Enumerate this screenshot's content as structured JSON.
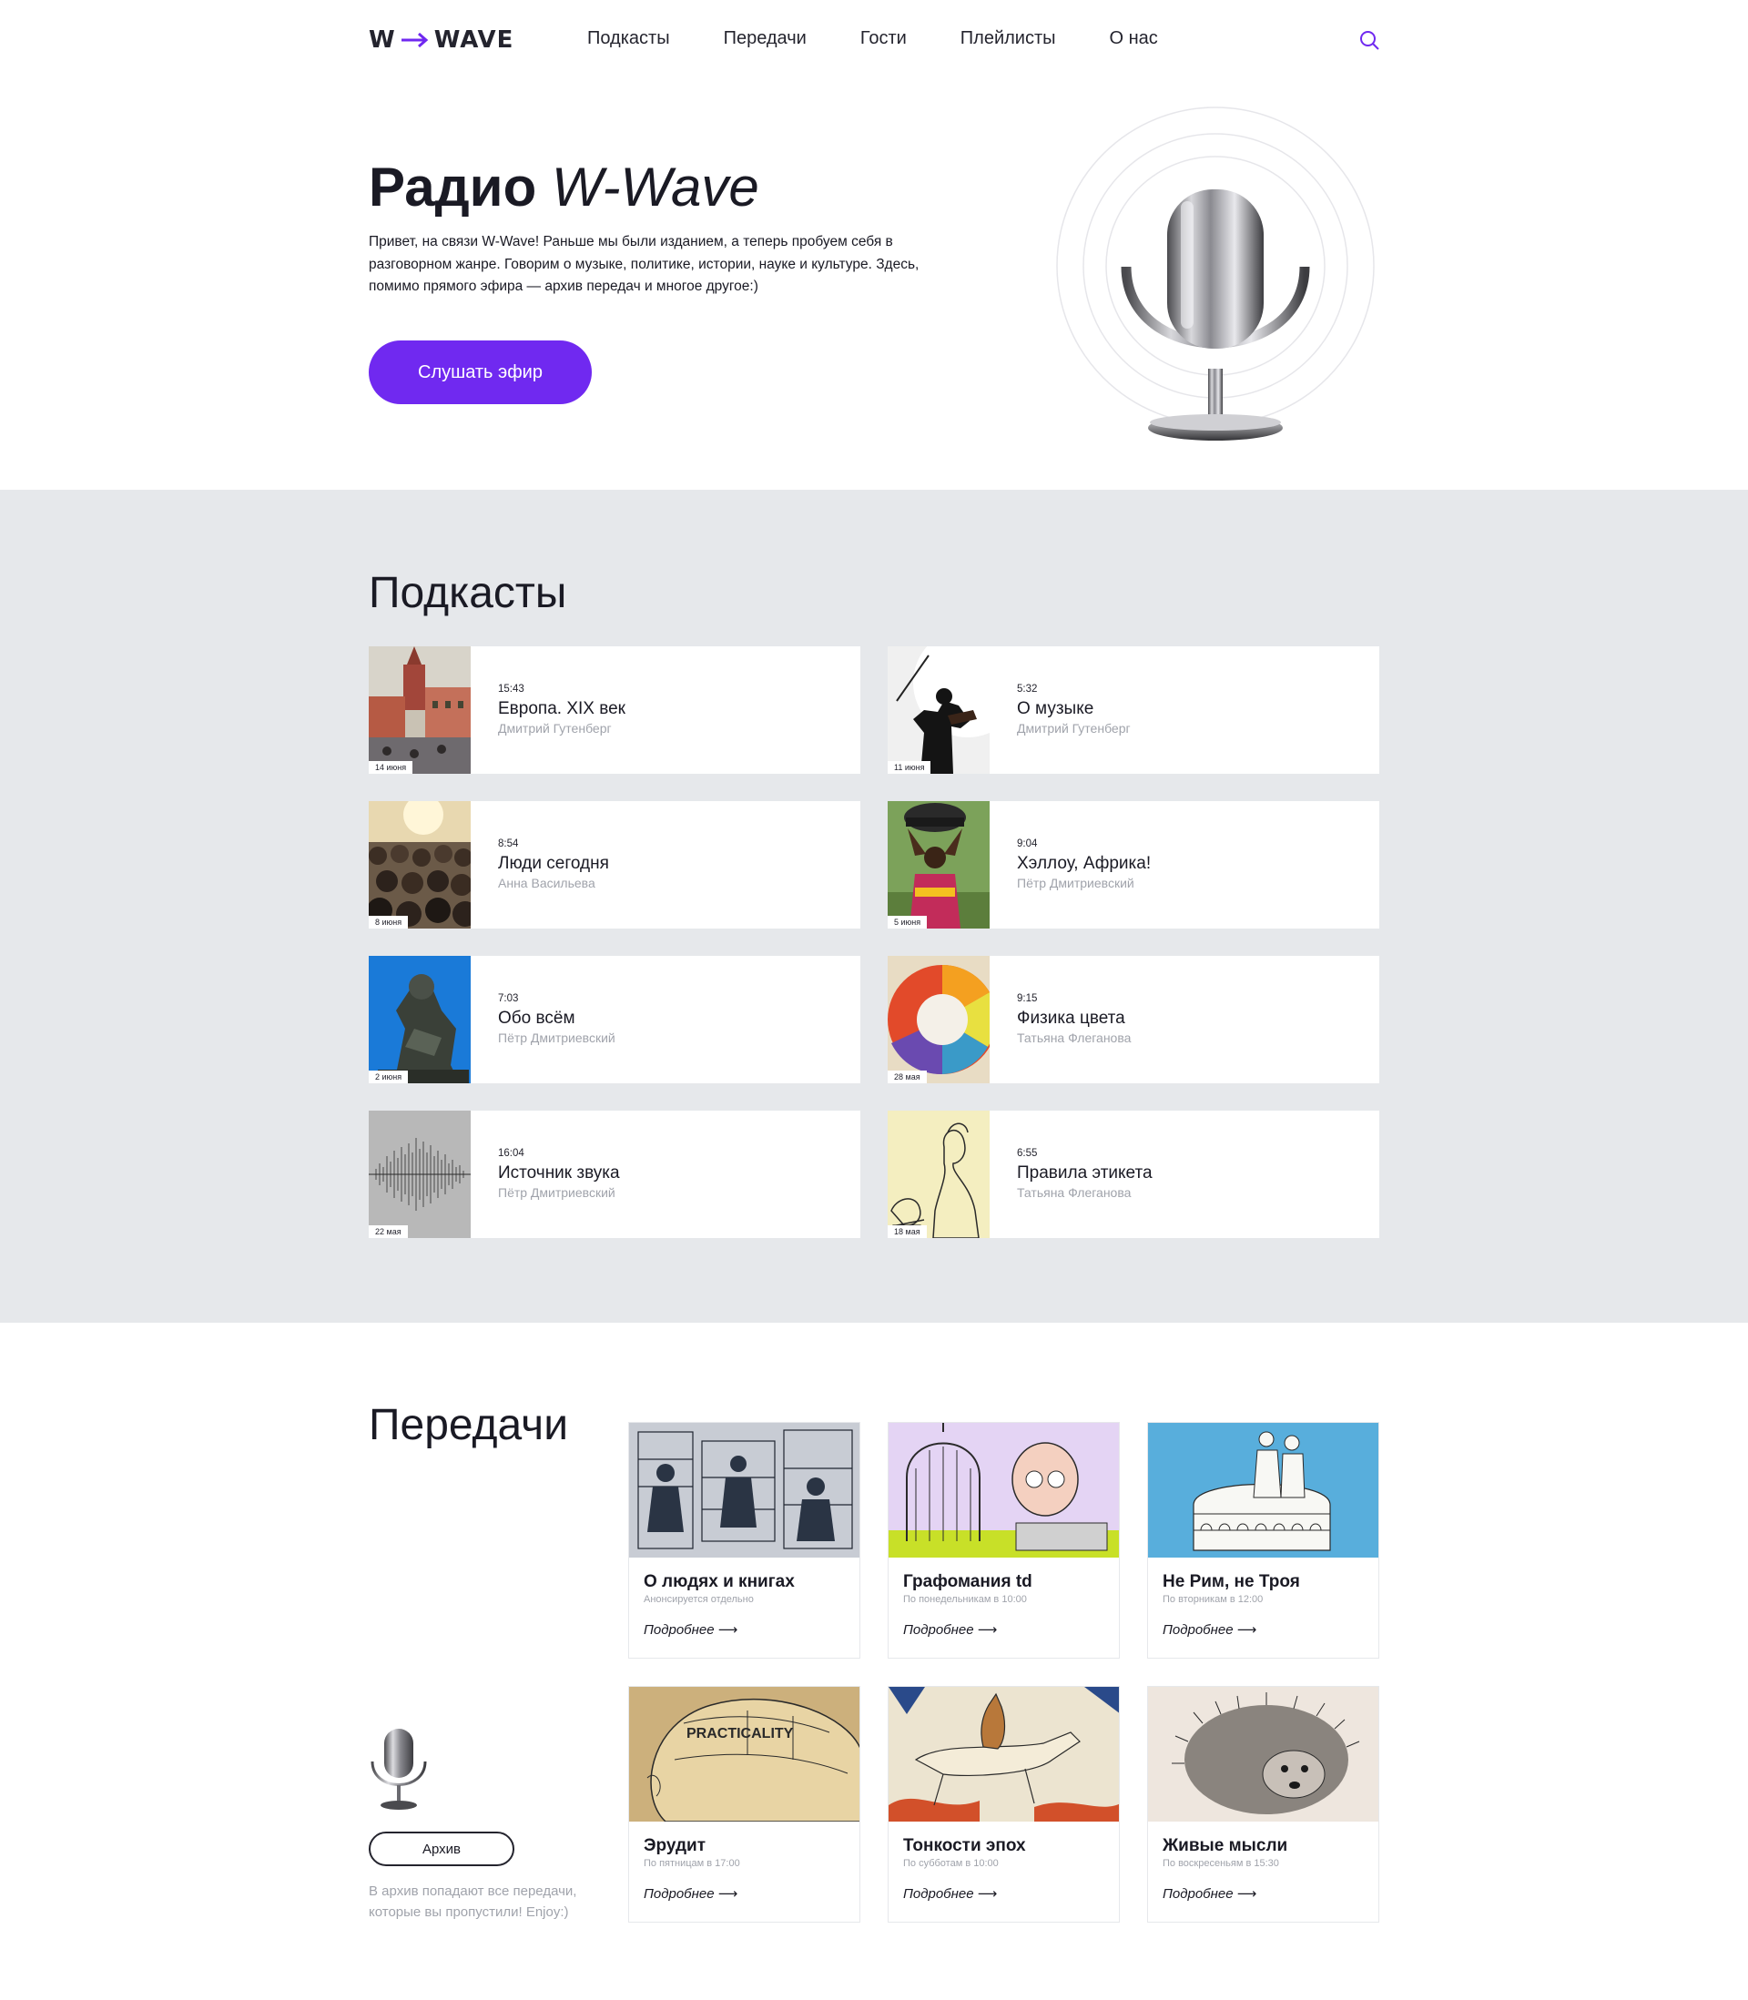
{
  "header": {
    "logo_left": "W",
    "logo_right": "WAVE",
    "nav": [
      "Подкасты",
      "Передачи",
      "Гости",
      "Плейлисты",
      "О нас"
    ],
    "accent": "#7029f0"
  },
  "hero": {
    "title_bold": "Радио",
    "title_italic": "W-Wave",
    "text": "Привет, на связи W-Wave! Раньше мы были изданием, а теперь пробуем себя в разговорном жанре. Говорим о музыке, политике, истории, науке и культуре. Здесь, помимо прямого эфира — архив передач и многое другое:)",
    "button": "Слушать эфир"
  },
  "podcasts": {
    "title": "Подкасты",
    "items": [
      {
        "duration": "15:43",
        "title": "Европа. XIX век",
        "author": "Дмитрий Гутенберг",
        "date": "14 июня",
        "image": "old-town-painting"
      },
      {
        "duration": "5:32",
        "title": "О музыке",
        "author": "Дмитрий Гутенберг",
        "date": "11 июня",
        "image": "violinist-silhouette"
      },
      {
        "duration": "8:54",
        "title": "Люди сегодня",
        "author": "Анна Васильева",
        "date": "8 июня",
        "image": "crowd-photo"
      },
      {
        "duration": "9:04",
        "title": "Хэллоу, Африка!",
        "author": "Пётр Дмитриевский",
        "date": "5 июня",
        "image": "woman-carrying-pot"
      },
      {
        "duration": "7:03",
        "title": "Обо всём",
        "author": "Пётр Дмитриевский",
        "date": "2 июня",
        "image": "thinker-statue"
      },
      {
        "duration": "9:15",
        "title": "Физика цвета",
        "author": "Татьяна Флеганова",
        "date": "28 мая",
        "image": "color-wheel"
      },
      {
        "duration": "16:04",
        "title": "Источник звука",
        "author": "Пётр Дмитриевский",
        "date": "22 мая",
        "image": "sound-wave"
      },
      {
        "duration": "6:55",
        "title": "Правила этикета",
        "author": "Татьяна Флеганова",
        "date": "18 мая",
        "image": "etiquette-engraving"
      }
    ]
  },
  "shows": {
    "title": "Передачи",
    "more_label": "Подробнее ⟶",
    "items": [
      {
        "title": "О людях и книгах",
        "schedule": "Анонсируется отдельно",
        "image": "printing-engraving"
      },
      {
        "title": "Графомания td",
        "schedule": "По понедельникам в 10:00",
        "image": "typewriter-cartoon"
      },
      {
        "title": "Не Рим, не Троя",
        "schedule": "По вторникам в 12:00",
        "image": "colosseum-engraving"
      },
      {
        "title": "Эрудит",
        "schedule": "По пятницам в 17:00",
        "image": "phrenology-head"
      },
      {
        "title": "Тонкости эпох",
        "schedule": "По субботам в 10:00",
        "image": "medieval-rabbit"
      },
      {
        "title": "Живые мысли",
        "schedule": "По воскресеньям в 15:30",
        "image": "hedgehog-engraving"
      }
    ],
    "archive_button": "Архив",
    "archive_text": "В архив попадают все передачи, которые вы пропустили! Enjoy:)"
  }
}
